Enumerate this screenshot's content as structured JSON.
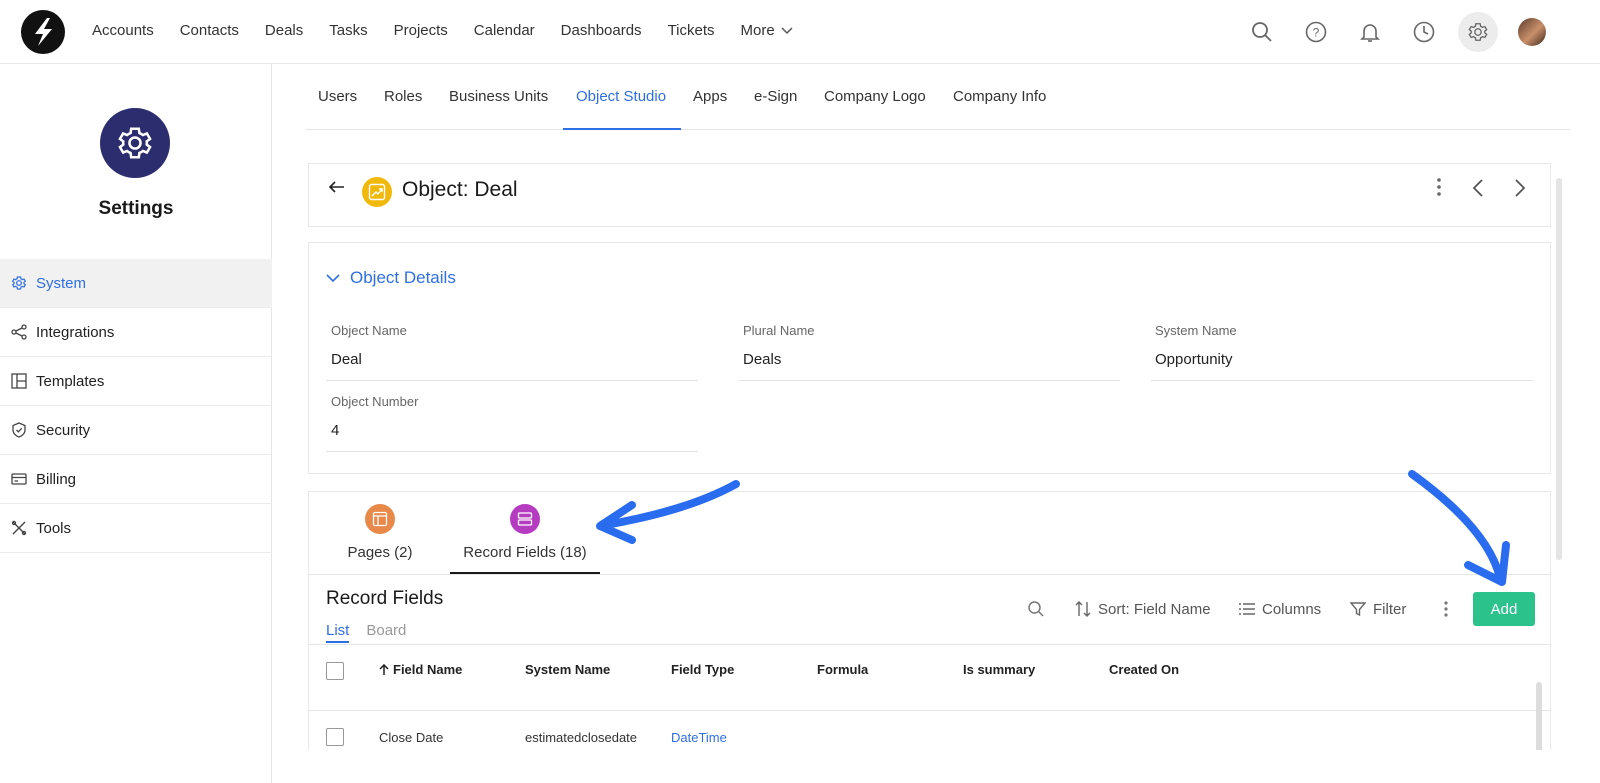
{
  "topnav": {
    "links": [
      "Accounts",
      "Contacts",
      "Deals",
      "Tasks",
      "Projects",
      "Calendar",
      "Dashboards",
      "Tickets",
      "More"
    ],
    "icons": [
      "search-icon",
      "help-icon",
      "bell-icon",
      "clock-icon",
      "gear-icon"
    ]
  },
  "sidebar": {
    "title": "Settings",
    "items": [
      {
        "label": "System",
        "icon": "gear-icon"
      },
      {
        "label": "Integrations",
        "icon": "share-icon"
      },
      {
        "label": "Templates",
        "icon": "template-icon"
      },
      {
        "label": "Security",
        "icon": "shield-icon"
      },
      {
        "label": "Billing",
        "icon": "card-icon"
      },
      {
        "label": "Tools",
        "icon": "tools-icon"
      }
    ]
  },
  "tabs": [
    "Users",
    "Roles",
    "Business Units",
    "Object Studio",
    "Apps",
    "e-Sign",
    "Company Logo",
    "Company Info"
  ],
  "object": {
    "title": "Object: Deal"
  },
  "details": {
    "heading": "Object Details",
    "fields": [
      {
        "label": "Object Name",
        "value": "Deal"
      },
      {
        "label": "Plural Name",
        "value": "Deals"
      },
      {
        "label": "System Name",
        "value": "Opportunity"
      },
      {
        "label": "Object Number",
        "value": "4"
      }
    ]
  },
  "record_tabs": [
    {
      "label": "Pages (2)",
      "color": "#e8894a"
    },
    {
      "label": "Record Fields (18)",
      "color": "#b53cc0"
    }
  ],
  "record_fields": {
    "title": "Record Fields",
    "views": [
      "List",
      "Board"
    ],
    "toolbar": {
      "sort": "Sort: Field Name",
      "columns": "Columns",
      "filter": "Filter",
      "add": "Add"
    },
    "columns": [
      "Field Name",
      "System Name",
      "Field Type",
      "Formula",
      "Is summary",
      "Created On"
    ],
    "rows": [
      {
        "field_name": "Close Date",
        "system_name": "estimatedclosedate",
        "field_type": "DateTime"
      }
    ]
  },
  "colors": {
    "accent": "#2f6fe4",
    "add_button": "#2bc28c",
    "annotation_arrow": "#2a6cf0"
  }
}
